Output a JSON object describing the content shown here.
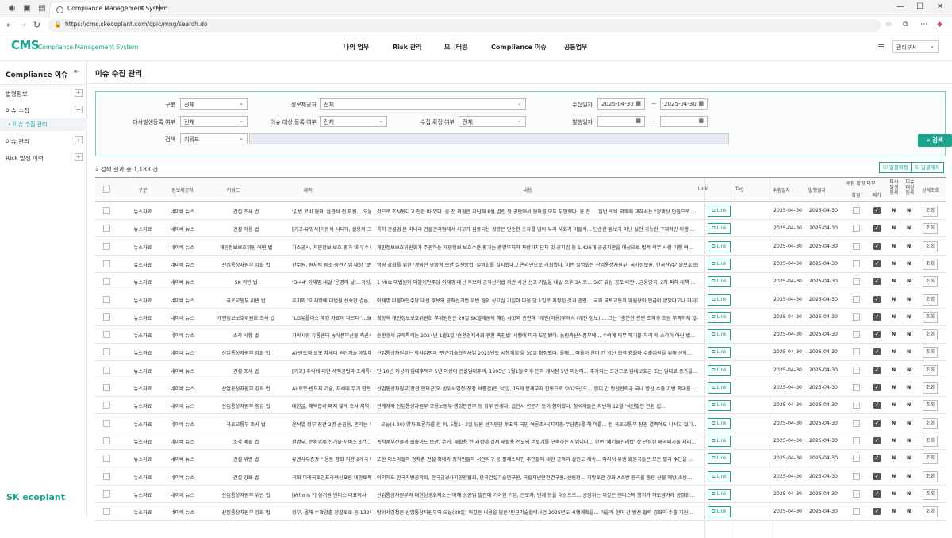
{
  "browser": {
    "tab_title": "Compliance Management System",
    "url": "https://cms.skecoplant.com/cpic/mng/search.do"
  },
  "header": {
    "logo": "CMS",
    "logo_sub": "Compliance Management System",
    "menu": [
      "나의 업무",
      "Risk 관리",
      "모니터링",
      "Compliance 이슈",
      "공통업무"
    ],
    "dept": "관리부서"
  },
  "sidebar": {
    "title": "Compliance 이슈",
    "items": [
      {
        "label": "법령정보"
      },
      {
        "label": "이슈 수집"
      },
      {
        "label": "이슈 관리"
      },
      {
        "label": "Risk 발생 이력"
      }
    ],
    "sub_active": "이슈 수집 관리",
    "footer_logo": "SK ecoplant"
  },
  "page": {
    "title": "이슈 수집 관리"
  },
  "search": {
    "l_gubun": "구분",
    "v_gubun": "전체",
    "l_source": "정보제공처",
    "v_source": "전체",
    "l_collect_date": "수집일자",
    "v_date_from": "2025-04-30",
    "v_date_to": "2025-04-30",
    "l_other": "타사발생등록 여부",
    "v_other": "전체",
    "l_target": "이슈 대상 등록 여부",
    "v_target": "전체",
    "l_confirm": "수집 확정 여부",
    "v_confirm": "전체",
    "l_occur": "발행일자",
    "l_keyword": "검색",
    "v_keyword": "키워드",
    "button": "검색",
    "tilde": "~"
  },
  "results": {
    "count_text": "검색 결과 총 1,183 건",
    "btn_confirm": "일괄확정",
    "btn_cancel": "일괄해지"
  },
  "table": {
    "headers": {
      "gubun": "구분",
      "source": "정보제공처",
      "keyword": "키워드",
      "title": "제목",
      "content": "내용",
      "link": "Link",
      "tag": "Tag",
      "collect": "수집일자",
      "publish": "발행일자",
      "confirm_group": "수집 확정 여부",
      "confirm": "확정",
      "cancel": "폐기",
      "other": "타사 발생 등록",
      "target": "이슈 대상 등록",
      "detail": "상세조회"
    },
    "link_label": "Link",
    "view_label": "조회",
    "rows": [
      {
        "gubun": "뉴스자료",
        "source": "네이버 뉴스",
        "keyword": "건설 조사 법",
        "title": "'입법 로비 혐의' 윤관석 전 의원… 오늘 1…",
        "content": "것으로 조사됐다고 전한 바 있다. 윤 전 의원은 지난해 8월 열린 첫 공판에서 혐의를 모두 부인했다. 윤 전 … 입법 로비 의혹에 대해서는 \"정책상 민원으로 …",
        "collect": "2025-04-30",
        "publish": "2025-04-30",
        "other": "N",
        "target": "N"
      },
      {
        "gubun": "뉴스자료",
        "source": "네이버 뉴스",
        "keyword": "건설 어음 법",
        "title": "[기고-유영석]이동식 시디의, 실용적 그…",
        "content": "특히 건설업 본 아니라 건물관리업에서 사고가 집중되는 경향은 단순한 숫자를 넘어 우리 사회가 이들식… 단순한 흥보가 아닌 실천 가능한 구체적인 이행 …",
        "collect": "2025-04-30",
        "publish": "2025-04-30",
        "other": "N",
        "target": "N"
      },
      {
        "gubun": "뉴스자료",
        "source": "네이버 뉴스",
        "keyword": "개인정보보호위원 어떤 법",
        "title": "가스공사, 저인정보 보호 평가 '최우수 S…",
        "content": "개인정보보호위원회가 주관하는 개인정보 보호수준 평가는 중앙부처와 자방자치단체 및 공기업 등 1,426개 공공기관을 대상으로 법적 의무 사항 이행 여…",
        "collect": "2025-04-30",
        "publish": "2025-04-30",
        "other": "N",
        "target": "N"
      },
      {
        "gubun": "뉴스자료",
        "source": "네이버 뉴스",
        "keyword": "산업통상자원부 강화 법",
        "title": "한수원, 원자력 중소·중견기업 대상 '보안…",
        "content": "역량 강화를 위한 '경영전 맞춤형 보안 실천방법' 설명회를 실시했다고 온라인으로 개최했다. 이번 설명회는 산업통상자원부, 국가정보원, 한국산업기술보호협회, 한국전…",
        "collect": "2025-04-30",
        "publish": "2025-04-30",
        "other": "N",
        "target": "N"
      },
      {
        "gubun": "뉴스자료",
        "source": "네이버 뉴스",
        "keyword": "SK 위반 법",
        "title": "'D-44' 이재명 내일 '운명의 날'…국힘, …",
        "content": "1 MHz 대법원이 더불어민주당 이재명 대선 후보의 공직선거법 위반 사건 선고 기일을 내일 오후 3시로… SKT 유심 공포 대란…금융당국, 2차 피해 대책 …",
        "collect": "2025-04-30",
        "publish": "2025-04-30",
        "other": "N",
        "target": "N"
      },
      {
        "gubun": "뉴스자료",
        "source": "네이버 뉴스",
        "keyword": "국토교통부 위반 법",
        "title": "주미의 \"이재명에 대법원 신속한 결론, …",
        "content": "이재명 더불어민주당 대선 후보의 공직선거법 위반 혐의 상고심 기일이 다음 달 1일로 지정된 것과 관련… 국회 국토교통위 위원장이 언급이 없었다고나 하자며 …",
        "collect": "2025-04-30",
        "publish": "2025-04-30",
        "other": "N",
        "target": "N"
      },
      {
        "gubun": "뉴스자료",
        "source": "네이버 뉴스",
        "keyword": "개인정보보호위원회 조사 법",
        "title": "\"LG유플러스 해킹 자료이 다르다\"…SKT…",
        "content": "최장혁 개인정보보호위원회 부위원장은 29일 SK텔레콤의 해킹 사고와 관련해 \"개인(이용)부에서 (개인 정보) … 그는 \"충분한 관련 조치가 조금 부족하지 않나…",
        "collect": "2025-04-30",
        "publish": "2025-04-30",
        "other": "N",
        "target": "N"
      },
      {
        "gubun": "뉴스자료",
        "source": "네이버 뉴스",
        "keyword": "소각 시행 법",
        "title": "가락시장 유통센터 농식품부산물 축산시…",
        "content": "순환경제 규제특례는 2024년 1월1일 '순환경제사회 전환 촉진법' 시행에 따라 도입됐다. 농림축산식품부에… 수박에 의무 폐기물 처리 때 소각이 아닌 법…",
        "collect": "2025-04-30",
        "publish": "2025-04-30",
        "other": "N",
        "target": "N"
      },
      {
        "gubun": "뉴스자료",
        "source": "네이버 뉴스",
        "keyword": "산업통상자원부 강화 법",
        "title": "AI·반도체·로봇 차세대 원전기술 개발에…",
        "content": "산업통상자원부는 박사업평과 '민군기술협력사업 2025년도 시행계획'을 30일 확정했다. 올해… 아울러 한미 간 방산 협력 강화와 수출지원을 위해 산학…",
        "collect": "2025-04-30",
        "publish": "2025-04-30",
        "other": "N",
        "target": "N"
      },
      {
        "gubun": "뉴스자료",
        "source": "네이버 뉴스",
        "keyword": "건설 조사 법",
        "title": "[기고] 추락에 대한 세액공법과 조세특례",
        "content": "단 10년 이상의 임대주택과 5년 이상의 건설임대주택, 1995년 1월1일 이후 인허 게시된 5년 이상의… 주가되는 조건으로 임대보호금 또는 임대료 증가율…",
        "collect": "2025-04-30",
        "publish": "2025-04-30",
        "other": "N",
        "target": "N"
      },
      {
        "gubun": "뉴스자료",
        "source": "네이버 뉴스",
        "keyword": "산업통상자원부 강화 법",
        "title": "AI·로봇·반도체 기술, 차세대 무기 만든다",
        "content": "산업통상자원부(장관 안덕근)와 방위사업청(청장 석종건)은 30일, 15개 분계부처 합동으로 '2025년도… 한미 간 방산협력과 국내 방산 수출 기반 확대를 …",
        "collect": "2025-04-30",
        "publish": "2025-04-30",
        "other": "N",
        "target": "N"
      },
      {
        "gubun": "뉴스자료",
        "source": "네이버 뉴스",
        "keyword": "산업통상자원부 점검 법",
        "title": "대한굴, 해택합리 폐지 및게 조사 지역 지폐…",
        "content": "관계자와 산업통상자원부·고용노동부·행정안전부 등 정부 관계자, 법전사 전문가 등이 참여했다. 참석자들은 지난해 12월 '석탄발전 전환 법…",
        "collect": "2025-04-30",
        "publish": "2025-04-30",
        "other": "N",
        "target": "N"
      },
      {
        "gubun": "뉴스자료",
        "source": "네이버 뉴스",
        "keyword": "국토교통부 조사 법",
        "title": "윤석열 정부 장관 2명 손꼽음, 흔리는 부…",
        "content": "– 오늘(4.30) 양자 토론하를 한 뒤, 5월1~2일 당원 선거인단 투표와 국민 여론조사(지지층·무당층)를 해 이를… 전 국토교통부 장관 결측에도 나서고 있다…",
        "collect": "2025-04-30",
        "publish": "2025-04-30",
        "other": "N",
        "target": "N"
      },
      {
        "gubun": "뉴스자료",
        "source": "네이버 뉴스",
        "keyword": "소각 배출 법",
        "title": "환경부, 순환경제 신기술·서비스 3건…",
        "content": "농식품부산물의 퇴출이드 보관, 수거, 재활용 전 과정에 걸쳐 재활용 선도의 본보기를 구축하는 사업이다… 한편 '폐기물관리법' 상 인정된 왜곡폐기물 처리…",
        "collect": "2025-04-30",
        "publish": "2025-04-30",
        "other": "N",
        "target": "N"
      },
      {
        "gubun": "뉴스자료",
        "source": "네이버 뉴스",
        "keyword": "건설 위반 법",
        "title": "유엔사우총장 \" 응동 평화 위한 2개국 체…",
        "content": "또한 이스라엘의 정착촌 건설 확대와 정착민들의 서안지구 등 팔레스타인 주민들에 대한 공격과 살인도 계속… 따라서 유엔 회원국들은 모든 필과 수단을 …",
        "collect": "2025-04-30",
        "publish": "2025-04-30",
        "other": "N",
        "target": "N"
      },
      {
        "gubun": "뉴스자료",
        "source": "네이버 뉴스",
        "keyword": "건설 강화 법",
        "title": "국회 미래국토인프라혁신포럼 대한토목…",
        "content": "이외에도 한국지반공학회, 한국급경사지안전협회, 한국건설기술연구원, 국립재난안전연구원, 산림청… 지방토관 강화 A소방 관리를 통한 산불 예방 소방…",
        "collect": "2025-04-30",
        "publish": "2025-04-30",
        "other": "N",
        "target": "N"
      },
      {
        "gubun": "뉴스자료",
        "source": "네이버 뉴스",
        "keyword": "산업통상자원부 위반 법",
        "title": "[Who is ?] 삼기원 덴티스 대표이사",
        "content": "산업통상자원부와 대한상공회의소는 매해 상공업 발전에 기여한 기업, 근로자, 단체 등을 대상으로… 공정위는 이같은 덴티스의 행위가 하도급거래 공정화…",
        "collect": "2025-04-30",
        "publish": "2025-04-30",
        "other": "N",
        "target": "N"
      },
      {
        "gubun": "뉴스자료",
        "source": "네이버 뉴스",
        "keyword": "산업통상자원부 강화 법",
        "title": "정부, 올해 수확양출 정찰로로 등 132개 …",
        "content": "방위사업청은 산업통상자원부와 오늘(30일) 이같은 내용을 담은 '민군기술협력사업 2025년도 시행계획을… 아울러 한미 간 방산 협력 강화와 수출 지원…",
        "collect": "2025-04-30",
        "publish": "2025-04-30",
        "other": "N",
        "target": "N"
      }
    ]
  }
}
